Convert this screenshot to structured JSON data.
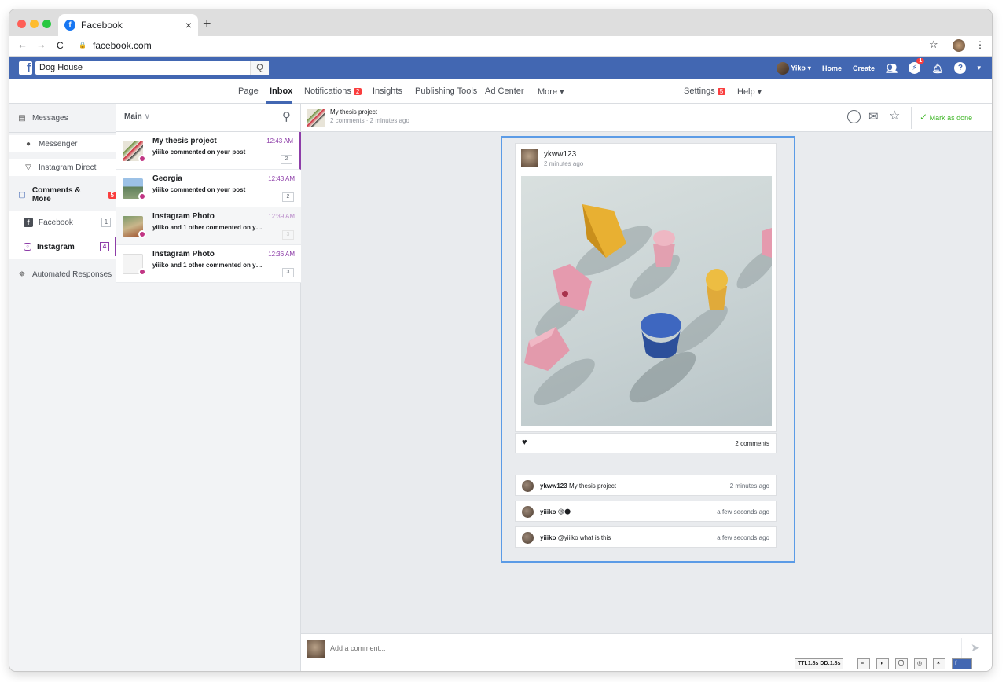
{
  "browser": {
    "tab_title": "Facebook",
    "tab_close": "×",
    "new_tab": "+",
    "url": "facebook.com",
    "back": "←",
    "forward": "→",
    "reload": "C",
    "lock": "🔒",
    "star": "☆",
    "menu": "⋮"
  },
  "fbbar": {
    "logo": "f",
    "search_value": "Dog House",
    "search_icon": "Q",
    "user": "Yiko",
    "user_caret": "▾",
    "home": "Home",
    "create": "Create",
    "messages_badge": "1",
    "help_icon": "?",
    "caret": "▾"
  },
  "pagenav": {
    "page": "Page",
    "inbox": "Inbox",
    "notifications": "Notifications",
    "notifications_badge": "2",
    "insights": "Insights",
    "publishing_tools": "Publishing Tools",
    "ad_center": "Ad Center",
    "more": "More ▾",
    "settings": "Settings",
    "settings_badge": "5",
    "help": "Help ▾"
  },
  "left": {
    "messages": "Messages",
    "messenger": "Messenger",
    "instagram_direct": "Instagram Direct",
    "comments_more": "Comments & More",
    "comments_badge": "5",
    "facebook": "Facebook",
    "facebook_count": "1",
    "instagram": "Instagram",
    "instagram_count": "4",
    "automated": "Automated Responses"
  },
  "list": {
    "filter": "Main",
    "threads": [
      {
        "title": "My thesis project",
        "sub": "yiiiko commented on your post",
        "time": "12:43 AM",
        "count": "2"
      },
      {
        "title": "Georgia",
        "sub": "yiiiko commented on your post",
        "time": "12:43 AM",
        "count": "2"
      },
      {
        "title": "Instagram Photo",
        "sub": "yiiiko and 1 other commented on your post",
        "time": "12:39 AM",
        "count": "3"
      },
      {
        "title": "Instagram Photo",
        "sub": "yiiiko and 1 other commented on your post",
        "time": "12:36 AM",
        "count": "3"
      }
    ]
  },
  "main": {
    "header_title": "My thesis project",
    "header_sub": "2 comments · 2 minutes ago",
    "mark_done": "Mark as done",
    "mark_icon": "✓",
    "post": {
      "author": "ykww123",
      "time": "2 minutes ago",
      "comments_count": "2 comments",
      "heart": "♥"
    },
    "comments": [
      {
        "user": "ykww123",
        "text": "My thesis project",
        "time": "2 minutes ago"
      },
      {
        "user": "yiiiko",
        "text": "😍🌑",
        "time": "a few seconds ago"
      },
      {
        "user": "yiiiko",
        "text": "@yiiiko what is this",
        "time": "a few seconds ago"
      }
    ],
    "composer_placeholder": "Add a comment...",
    "send_icon": "➤"
  },
  "debug": {
    "tti": "TTI:1.8s DD:1.8s"
  },
  "colors": {
    "fb_blue": "#4267b2",
    "badge_red": "#fa3e3e",
    "focus_blue": "#5b9be6",
    "done_green": "#42b72a"
  }
}
